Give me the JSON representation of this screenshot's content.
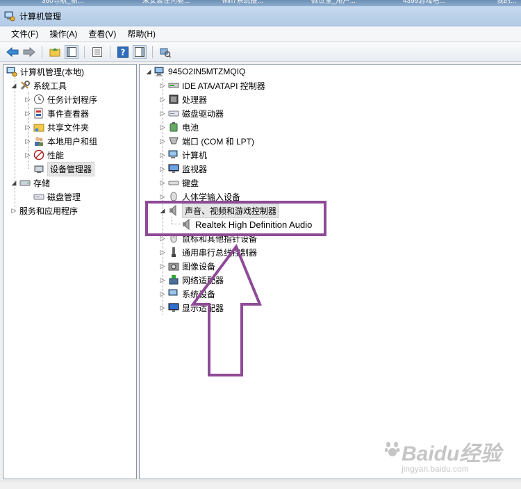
{
  "browser_tabs": [
    "360导航_新...",
    "未安装任何驱...",
    "win7系统提...",
    "微世堂_用户...",
    "4399游戏吧...",
    "我的..."
  ],
  "window": {
    "title": "计算机管理"
  },
  "menu": [
    "文件(F)",
    "操作(A)",
    "查看(V)",
    "帮助(H)"
  ],
  "toolbar": {
    "icons": [
      "back-arrow-icon",
      "forward-arrow-icon",
      "up-folder-icon",
      "show-hide-tree-icon",
      "properties-icon",
      "help-icon",
      "action-pane-icon",
      "scan-hardware-icon"
    ]
  },
  "left_tree": {
    "root": "计算机管理(本地)",
    "system_tools": "系统工具",
    "task_scheduler": "任务计划程序",
    "event_viewer": "事件查看器",
    "shared_folders": "共享文件夹",
    "local_users": "本地用户和组",
    "performance": "性能",
    "device_manager": "设备管理器",
    "storage": "存储",
    "disk_management": "磁盘管理",
    "services": "服务和应用程序"
  },
  "device_tree": {
    "computer_name": "945O2IN5MTZMQIQ",
    "categories": [
      "IDE ATA/ATAPI 控制器",
      "处理器",
      "磁盘驱动器",
      "电池",
      "端口 (COM 和 LPT)",
      "计算机",
      "监视器",
      "键盘",
      "人体学输入设备",
      "声音、视频和游戏控制器",
      "鼠标和其他指针设备",
      "通用串行总线控制器",
      "图像设备",
      "网络适配器",
      "系统设备",
      "显示适配器"
    ],
    "expanded_child": "Realtek High Definition Audio"
  },
  "annotation": {
    "color": "#8e4a97"
  },
  "watermark": {
    "main": "Baidu经验",
    "sub": "jingyan.baidu.com"
  }
}
